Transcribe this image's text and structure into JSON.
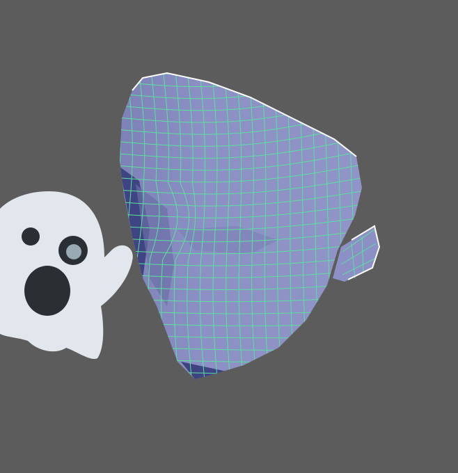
{
  "viewport": {
    "background_color": "#5c5c5c",
    "shading_mode": "wireframe-on-shaded"
  },
  "mesh": {
    "object": "head-mesh",
    "fill_color": "#8a8ec0",
    "shadow_color": "#6b6fa6",
    "deep_shadow_color": "#2a2f70",
    "wire_color": "#5de0a0",
    "selection_outline_color": "#ffffff",
    "selected": true
  },
  "overlay": {
    "icon": "ghost-icon",
    "body_color": "#e2e7ee",
    "feature_color": "#292f33",
    "pupil_color": "#99aab5"
  }
}
